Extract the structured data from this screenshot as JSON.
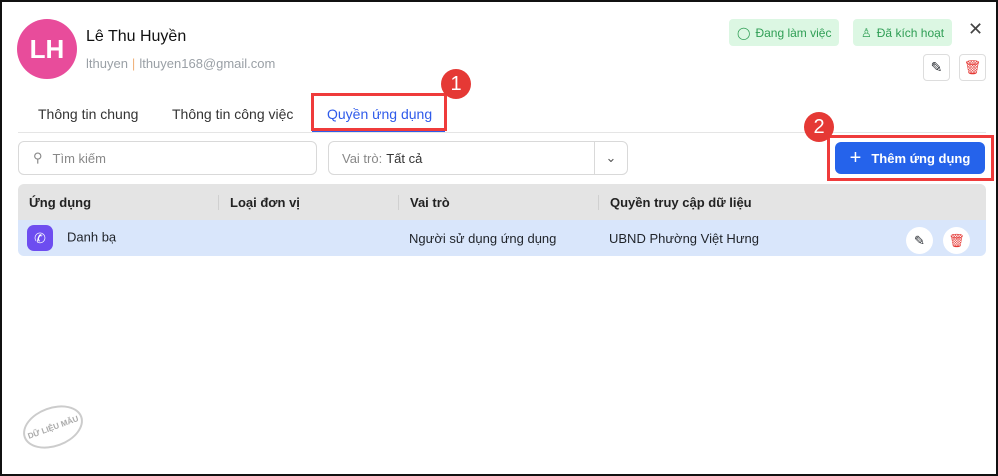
{
  "user": {
    "initials": "LH",
    "name": "Lê Thu Huyền",
    "username": "lthuyen",
    "email": "lthuyen168@gmail.com"
  },
  "badges": {
    "status": "Đang làm việc",
    "activation": "Đã kích hoạt"
  },
  "tabs": [
    "Thông tin chung",
    "Thông tin công việc",
    "Quyền ứng dụng"
  ],
  "annotations": [
    "1",
    "2"
  ],
  "search": {
    "placeholder": "Tìm kiếm"
  },
  "role_filter": {
    "label": "Vai trò:",
    "value": "Tất cả"
  },
  "add_button": "Thêm ứng dụng",
  "table": {
    "headers": [
      "Ứng dụng",
      "Loại đơn vị",
      "Vai trò",
      "Quyền truy cập dữ liệu"
    ],
    "rows": [
      {
        "app": "Danh bạ",
        "unit_type": "",
        "role": "Người sử dụng ứng dụng",
        "data_access": "UBND Phường Việt Hưng"
      }
    ]
  },
  "watermark": "DỮ LIỆU MẪU",
  "colors": {
    "accent": "#2563eb",
    "avatar": "#e84c9b",
    "success": "#2f9e55",
    "danger": "#e53935"
  }
}
